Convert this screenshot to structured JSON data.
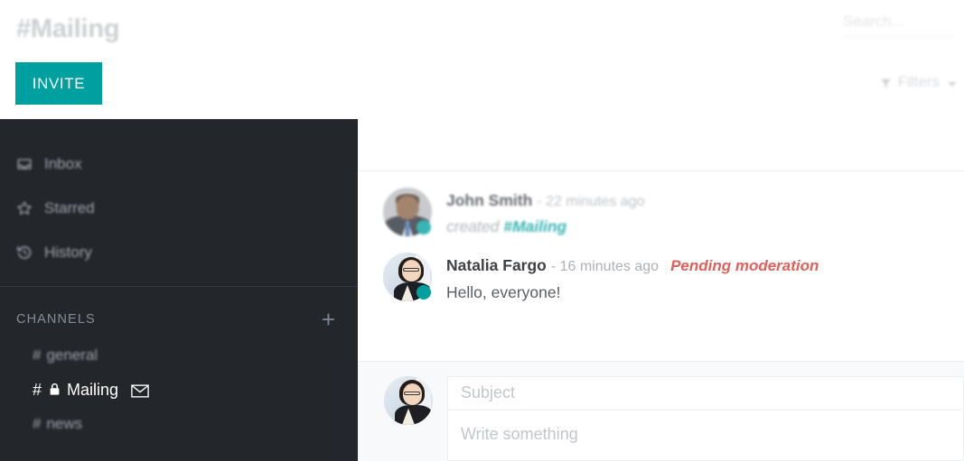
{
  "header": {
    "channel_title": "#Mailing",
    "invite_label": "INVITE",
    "search": {
      "placeholder": "Search...",
      "value": ""
    },
    "filters": {
      "label": "Filters",
      "icon": "funnel-icon",
      "caret": "chevron-down-icon"
    }
  },
  "sidebar": {
    "nav": [
      {
        "label": "Inbox",
        "icon": "inbox-icon"
      },
      {
        "label": "Starred",
        "icon": "star-icon"
      },
      {
        "label": "History",
        "icon": "history-icon"
      }
    ],
    "channels_section": {
      "title": "CHANNELS",
      "add_label": "+",
      "add_icon": "plus-icon"
    },
    "channels": [
      {
        "hash": "#",
        "name": "general",
        "active": false,
        "private": false,
        "mail": false
      },
      {
        "hash": "#",
        "name": "Mailing",
        "active": true,
        "private": true,
        "mail": true
      },
      {
        "hash": "#",
        "name": "news",
        "active": false,
        "private": false,
        "mail": false
      }
    ]
  },
  "main": {
    "messages": [
      {
        "author": "John Smith",
        "meta": "- 22 minutes ago",
        "badge": "",
        "text_prefix": "created ",
        "text_ref": "#Mailing",
        "text": "",
        "system": true,
        "faded": true,
        "avatar": "john-smith-avatar",
        "status": "online"
      },
      {
        "author": "Natalia Fargo",
        "meta": "- 16 minutes ago",
        "badge": "Pending moderation",
        "text_prefix": "",
        "text_ref": "",
        "text": "Hello, everyone!",
        "system": false,
        "faded": false,
        "avatar": "natalia-fargo-avatar",
        "status": "online"
      }
    ],
    "composer": {
      "avatar": "natalia-fargo-avatar",
      "subject": {
        "placeholder": "Subject",
        "value": ""
      },
      "body": {
        "placeholder": "Write something",
        "value": ""
      }
    }
  },
  "colors": {
    "accent_teal": "#00a0a0",
    "sidebar_dark": "#23272b",
    "pending_red": "#e0605b",
    "muted_text": "#adb1b6",
    "composer_bg": "#f7f9fa"
  }
}
